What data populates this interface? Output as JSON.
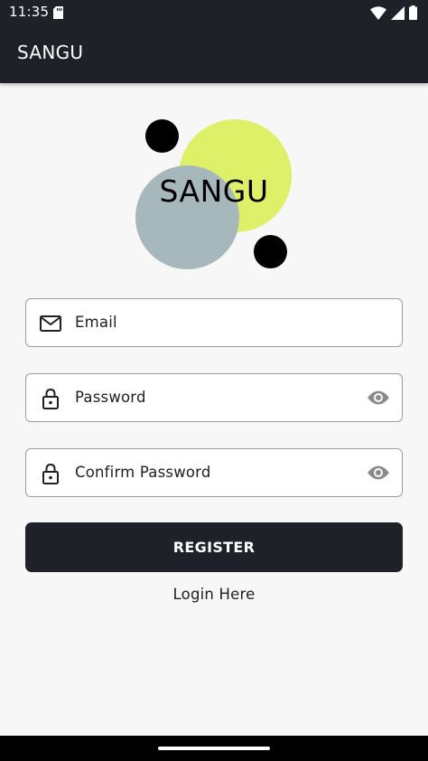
{
  "status_bar": {
    "time": "11:35",
    "icons": [
      "sd-card-icon",
      "wifi-icon",
      "signal-icon",
      "battery-icon"
    ]
  },
  "app_bar": {
    "title": "SANGU"
  },
  "logo": {
    "text": "SANGU",
    "colors": {
      "yellow": "#ddf068",
      "grey": "#a6b8bc",
      "dot": "#000000"
    }
  },
  "form": {
    "email": {
      "placeholder": "Email",
      "icon": "mail-icon"
    },
    "password": {
      "placeholder": "Password",
      "icon": "lock-icon",
      "toggle_icon": "eye-icon"
    },
    "confirm_password": {
      "placeholder": "Confirm Password",
      "icon": "lock-icon",
      "toggle_icon": "eye-icon"
    },
    "register_label": "REGISTER",
    "login_label": "Login Here"
  },
  "colors": {
    "primary": "#1f2129",
    "background": "#f7f7f7",
    "border": "#9c9c9c"
  }
}
